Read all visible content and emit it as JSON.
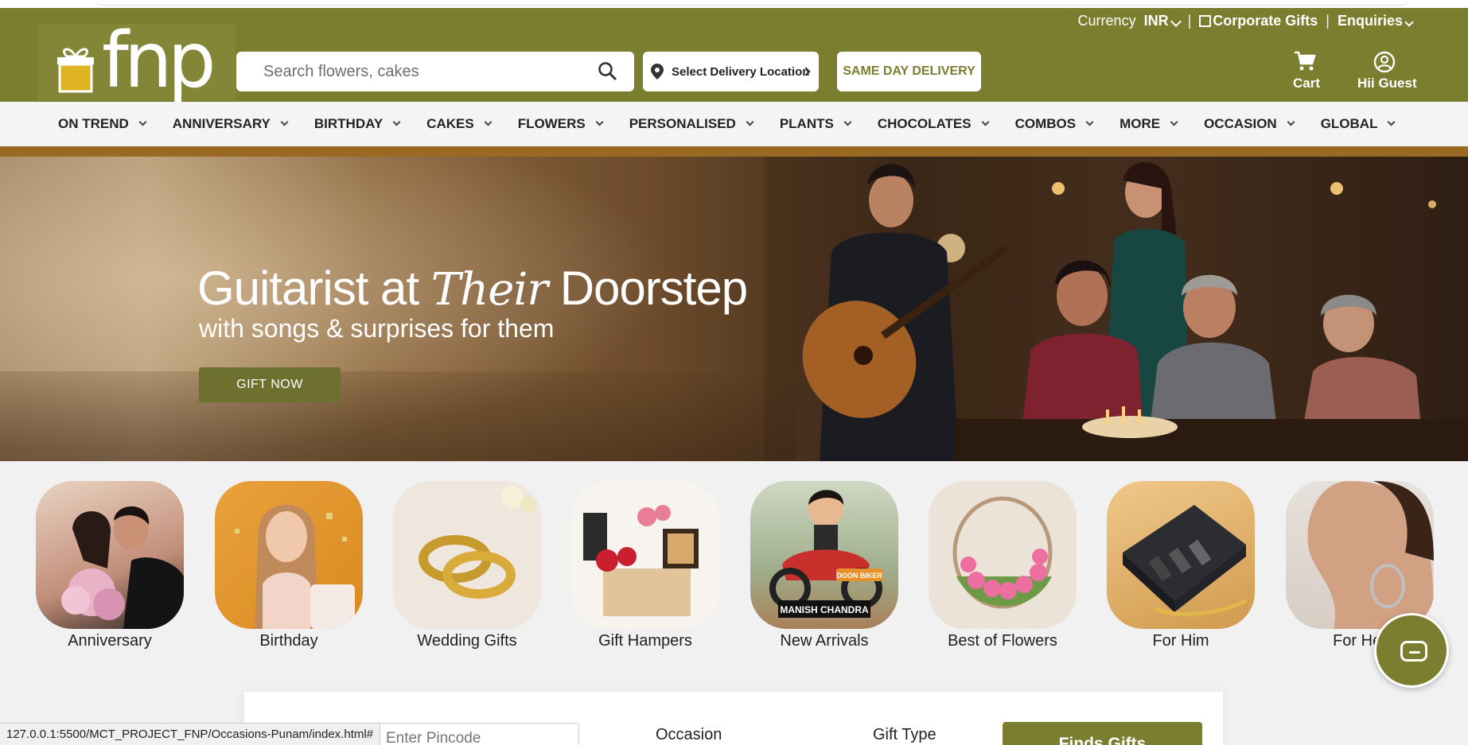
{
  "header": {
    "logo_text": "fnp",
    "topbar": {
      "currency_label": "Currency",
      "currency_value": "INR",
      "corporate_gifts": "Corporate Gifts",
      "enquiries": "Enquiries",
      "separator": "|"
    },
    "search": {
      "placeholder": "Search flowers, cakes"
    },
    "delivery_location": "Select Delivery Location",
    "same_day_delivery": "SAME DAY DELIVERY",
    "cart_label": "Cart",
    "user_label": "Hii Guest"
  },
  "nav": {
    "items": [
      "ON TREND",
      "ANNIVERSARY",
      "BIRTHDAY",
      "CAKES",
      "FLOWERS",
      "PERSONALISED",
      "PLANTS",
      "CHOCOLATES",
      "COMBOS",
      "MORE",
      "OCCASION",
      "GLOBAL"
    ]
  },
  "banner": {
    "title_part1": "Guitarist at",
    "title_script": "Their",
    "title_part2": "Doorstep",
    "subtitle": "with songs & surprises for them",
    "cta": "GIFT NOW"
  },
  "categories": [
    "Anniversary",
    "Birthday",
    "Wedding Gifts",
    "Gift Hampers",
    "New Arrivals",
    "Best of Flowers",
    "For Him",
    "For Her"
  ],
  "category_badges": {
    "biker_top": "DOON BIKER",
    "biker_name": "MANISH CHANDRA"
  },
  "finder": {
    "pincode_placeholder": "Enter Pincode",
    "occasion_label": "Occasion",
    "gift_type_label": "Gift Type",
    "button": "Finds Gifts"
  },
  "status_bar": "127.0.0.1:5500/MCT_PROJECT_FNP/Occasions-Punam/index.html#",
  "colors": {
    "brand_olive": "#7b7d2f",
    "nav_divider": "#9a6a24",
    "page_bg": "#f1f1f1"
  }
}
